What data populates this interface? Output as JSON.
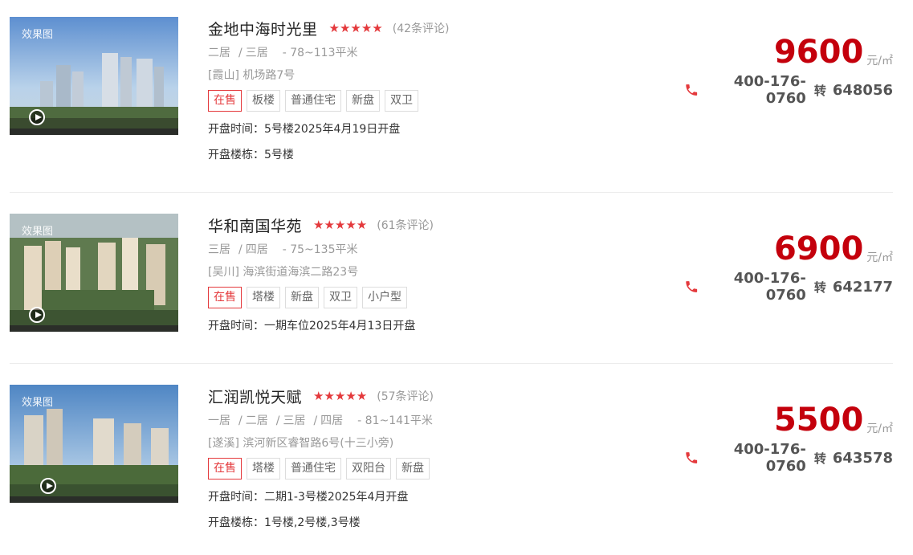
{
  "listings": [
    {
      "effect_label": "效果图",
      "title": "金地中海时光里",
      "stars": "★★★★★",
      "reviews": "(42条评论)",
      "rooms": [
        "二居",
        "三居"
      ],
      "area": "- 78~113平米",
      "district": "[霞山]",
      "street": "机场路7号",
      "tags": [
        "在售",
        "板楼",
        "普通住宅",
        "新盘",
        "双卫"
      ],
      "meta": [
        {
          "label": "开盘时间：",
          "value": "5号楼2025年4月19日开盘"
        },
        {
          "label": "开盘楼栋：",
          "value": "5号楼"
        }
      ],
      "price": "9600",
      "unit": "元/㎡",
      "phone": "400-176-0760",
      "ext_word": "转",
      "ext": "648056"
    },
    {
      "effect_label": "效果图",
      "title": "华和南国华苑",
      "stars": "★★★★★",
      "reviews": "(61条评论)",
      "rooms": [
        "三居",
        "四居"
      ],
      "area": "- 75~135平米",
      "district": "[吴川]",
      "street": "海滨街道海滨二路23号",
      "tags": [
        "在售",
        "塔楼",
        "新盘",
        "双卫",
        "小户型"
      ],
      "meta": [
        {
          "label": "开盘时间：",
          "value": "一期车位2025年4月13日开盘"
        }
      ],
      "price": "6900",
      "unit": "元/㎡",
      "phone": "400-176-0760",
      "ext_word": "转",
      "ext": "642177"
    },
    {
      "effect_label": "效果图",
      "title": "汇润凯悦天赋",
      "stars": "★★★★★",
      "reviews": "(57条评论)",
      "rooms": [
        "一居",
        "二居",
        "三居",
        "四居"
      ],
      "area": "- 81~141平米",
      "district": "[遂溪]",
      "street": "滨河新区睿智路6号(十三小旁)",
      "tags": [
        "在售",
        "塔楼",
        "普通住宅",
        "双阳台",
        "新盘"
      ],
      "meta": [
        {
          "label": "开盘时间：",
          "value": "二期1-3号楼2025年4月开盘"
        },
        {
          "label": "开盘楼栋：",
          "value": "1号楼,2号楼,3号楼"
        }
      ],
      "price": "5500",
      "unit": "元/㎡",
      "phone": "400-176-0760",
      "ext_word": "转",
      "ext": "643578"
    }
  ],
  "colors": {
    "accent_red": "#e4393c",
    "price_red": "#c4000c",
    "muted": "#999999"
  },
  "icons": [
    "play-icon",
    "star-icon",
    "phone-icon"
  ]
}
